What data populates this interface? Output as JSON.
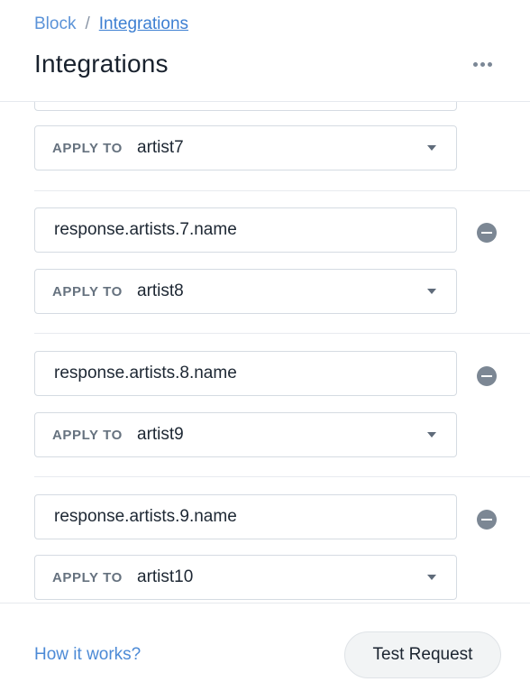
{
  "breadcrumb": {
    "root": "Block",
    "separator": "/",
    "current": "Integrations"
  },
  "header": {
    "title": "Integrations",
    "more_icon": "more-horizontal-icon"
  },
  "mappings": [
    {
      "path": "",
      "apply_label": "APPLY TO",
      "apply_value": "artist7"
    },
    {
      "path": "response.artists.7.name",
      "apply_label": "APPLY TO",
      "apply_value": "artist8"
    },
    {
      "path": "response.artists.8.name",
      "apply_label": "APPLY TO",
      "apply_value": "artist9"
    },
    {
      "path": "response.artists.9.name",
      "apply_label": "APPLY TO",
      "apply_value": "artist10"
    }
  ],
  "footer": {
    "help_link": "How it works?",
    "test_button": "Test Request"
  },
  "colors": {
    "link": "#3d7fd2",
    "minus_icon": "#7c8794",
    "border": "#d5dbe2"
  }
}
